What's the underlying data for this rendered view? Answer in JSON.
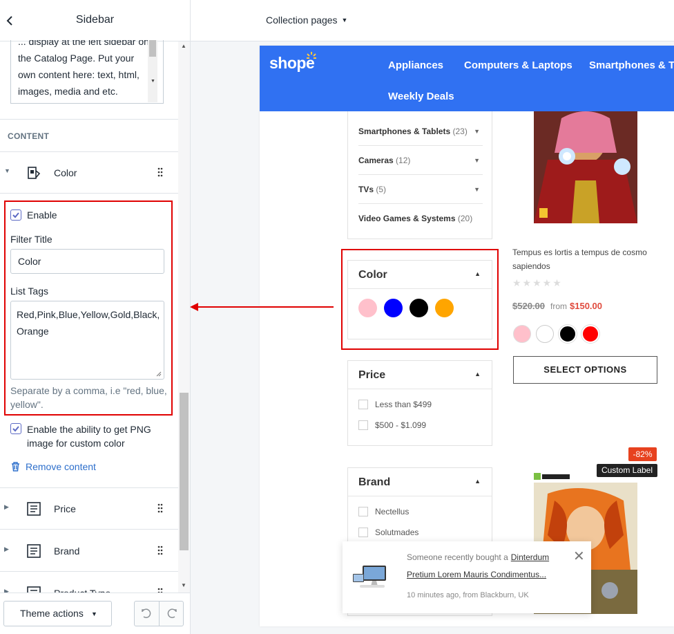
{
  "left_panel": {
    "title": "Sidebar",
    "back_icon": "chevron-left-icon",
    "textarea_content": "... display at the left sidebar on the Catalog Page. Put your own content here: text, html, images, media and etc.",
    "content_section_label": "CONTENT",
    "color_block": {
      "label": "Color",
      "icon": "paint-bucket-icon"
    },
    "enable_label": "Enable",
    "enable_checked": true,
    "filter_title_label": "Filter Title",
    "filter_title_value": "Color",
    "list_tags_label": "List Tags",
    "list_tags_value": "Red,Pink,Blue,Yellow,Gold,Black,\nOrange",
    "help_text": "Separate by a comma, i.e \"red, blue, yellow\".",
    "png_label": "Enable the ability to get PNG image for custom color",
    "png_checked": true,
    "remove_label": "Remove content",
    "other_blocks": [
      {
        "label": "Price",
        "icon": "text-block-icon"
      },
      {
        "label": "Brand",
        "icon": "text-block-icon"
      },
      {
        "label": "Product Type",
        "icon": "text-block-icon"
      }
    ],
    "theme_actions_label": "Theme actions",
    "undo_icon": "undo-icon",
    "redo_icon": "redo-icon"
  },
  "right_panel": {
    "collection_dropdown": "Collection pages",
    "store": {
      "logo": "shope",
      "nav": [
        "Appliances",
        "Computers & Laptops",
        "Smartphones & Ta",
        "Weekly Deals"
      ],
      "categories": [
        {
          "name": "Smartphones & Tablets",
          "count": "(23)"
        },
        {
          "name": "Cameras",
          "count": "(12)"
        },
        {
          "name": "TVs",
          "count": "(5)"
        },
        {
          "name": "Video Games & Systems",
          "count": "(20)"
        }
      ],
      "color_filter": {
        "title": "Color",
        "swatches": [
          "#ffc0cb",
          "#0000ff",
          "#000000",
          "#ffa500"
        ]
      },
      "price_filter": {
        "title": "Price",
        "options": [
          "Less than $499",
          "$500 - $1.099"
        ]
      },
      "brand_filter": {
        "title": "Brand",
        "options": [
          "Nectellus",
          "Solutmades"
        ]
      },
      "product": {
        "name": "Tempus es lortis a tempus de cosmo sapiendos",
        "old_price": "$520.00",
        "from_label": "from",
        "new_price": "$150.00",
        "swatches": [
          "#ffc0cb",
          "#ffffff",
          "#000000",
          "#ff0000"
        ],
        "button": "SELECT OPTIONS"
      },
      "second_product": {
        "discount": "-82%",
        "custom_label": "Custom Label"
      },
      "popup": {
        "line1_prefix": "Someone recently bought a",
        "product_name_a": "Dinterdum",
        "product_name_b": "Pretium Lorem Mauris Condimentus...",
        "meta": "10 minutes ago, from Blackburn, UK"
      }
    }
  },
  "colors": {
    "accent": "#5c6ac4",
    "highlight": "#e00000",
    "nav_bg": "#3071f2",
    "sale": "#e04b3e"
  }
}
